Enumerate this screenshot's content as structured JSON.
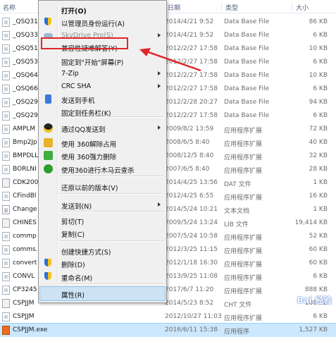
{
  "header": {
    "name": "名称",
    "date": "日期",
    "type": "类型",
    "size": "大小"
  },
  "files": [
    {
      "name": "_QSQ31",
      "date": "2014/4/21 9:52",
      "type": "Data Base File",
      "size": "86 KB",
      "icon": "app"
    },
    {
      "name": "_QSQ33",
      "date": "2014/4/21 9:52",
      "type": "Data Base File",
      "size": "6 KB",
      "icon": "app"
    },
    {
      "name": "_QSQ51",
      "date": "2012/2/27 17:58",
      "type": "Data Base File",
      "size": "10 KB",
      "icon": "app"
    },
    {
      "name": "_QSQ53",
      "date": "2012/2/27 17:58",
      "type": "Data Base File",
      "size": "6 KB",
      "icon": "app"
    },
    {
      "name": "_QSQ64",
      "date": "2012/2/27 17:58",
      "type": "Data Base File",
      "size": "10 KB",
      "icon": "app"
    },
    {
      "name": "_QSQ66",
      "date": "2012/2/27 17:58",
      "type": "Data Base File",
      "size": "6 KB",
      "icon": "app"
    },
    {
      "name": "_QSQ29",
      "date": "2012/2/28 20:27",
      "type": "Data Base File",
      "size": "94 KB",
      "icon": "app"
    },
    {
      "name": "_QSQ29",
      "date": "2012/2/27 17:58",
      "type": "Data Base File",
      "size": "6 KB",
      "icon": "app"
    },
    {
      "name": "AMPLM",
      "date": "2009/8/2 13:59",
      "type": "应用程序扩展",
      "size": "72 KB",
      "icon": "app"
    },
    {
      "name": "Bmp2Jp",
      "date": "2008/6/5 8:40",
      "type": "应用程序扩展",
      "size": "40 KB",
      "icon": "app"
    },
    {
      "name": "BMPDLL",
      "date": "2008/12/5 8:40",
      "type": "应用程序扩展",
      "size": "32 KB",
      "icon": "app"
    },
    {
      "name": "BORLNI",
      "date": "2007/6/5 8:40",
      "type": "应用程序扩展",
      "size": "28 KB",
      "icon": "app"
    },
    {
      "name": "CDK200",
      "date": "2014/4/25 13:56",
      "type": "DAT 文件",
      "size": "1 KB",
      "icon": "lib"
    },
    {
      "name": "CFindBl",
      "date": "2012/4/25 6:55",
      "type": "应用程序扩展",
      "size": "16 KB",
      "icon": "app"
    },
    {
      "name": "Change",
      "date": "2014/5/24 10:21",
      "type": "文本文档",
      "size": "1 KB",
      "icon": "txt"
    },
    {
      "name": "CHINES",
      "date": "2009/5/24 13:24",
      "type": "LIB 文件",
      "size": "19,414 KB",
      "icon": "lib"
    },
    {
      "name": "commp",
      "date": "2007/5/24 10:58",
      "type": "应用程序扩展",
      "size": "52 KB",
      "icon": "app"
    },
    {
      "name": "comms.",
      "date": "2012/3/25 11:15",
      "type": "应用程序扩展",
      "size": "60 KB",
      "icon": "app"
    },
    {
      "name": "convert",
      "date": "2012/1/18 16:30",
      "type": "应用程序扩展",
      "size": "60 KB",
      "icon": "app"
    },
    {
      "name": "CONVL",
      "date": "2013/9/25 11:08",
      "type": "应用程序扩展",
      "size": "6 KB",
      "icon": "app"
    },
    {
      "name": "CP3245",
      "date": "2017/6/7 11:20",
      "type": "应用程序扩展",
      "size": "888 KB",
      "icon": "app"
    },
    {
      "name": "CSPJJM",
      "date": "2014/5/23 8:52",
      "type": "CHT 文件",
      "size": "188 KB",
      "icon": "lib"
    },
    {
      "name": "CSPJJM",
      "date": "2012/10/27 11:03",
      "type": "应用程序扩展",
      "size": "6 KB",
      "icon": "app"
    },
    {
      "name": "CSPJJM.exe",
      "date": "2016/6/11 15:38",
      "type": "应用程序",
      "size": "1,527 KB",
      "icon": "orange"
    }
  ],
  "menu": {
    "items": [
      {
        "label": "打开(O)",
        "icon": "",
        "arrow": false,
        "bold": true
      },
      {
        "label": "以管理员身份运行(A)",
        "icon": "shield-icon",
        "arrow": false
      },
      {
        "label": "SkyDrive Pro(S)",
        "icon": "cloud-icon",
        "arrow": true,
        "disabled": true
      },
      {
        "label": "兼容性疑难解答(Y)",
        "icon": "",
        "arrow": false,
        "highlight": true
      },
      {
        "label": "固定到\"开始\"屏幕(P)",
        "icon": "",
        "arrow": false
      },
      {
        "label": "7-Zip",
        "icon": "",
        "arrow": true
      },
      {
        "label": "CRC SHA",
        "icon": "",
        "arrow": true
      },
      {
        "label": "发送到手机",
        "icon": "phone-icon",
        "arrow": false
      },
      {
        "label": "固定到任务栏(K)",
        "icon": "",
        "arrow": false
      },
      {
        "label": "通过QQ发送到",
        "icon": "qq-icon",
        "arrow": true
      },
      {
        "label": "使用 360解除占用",
        "icon": "360-unlock-icon",
        "arrow": false
      },
      {
        "label": "使用 360强力删除",
        "icon": "360-delete-icon",
        "arrow": false
      },
      {
        "label": "使用360进行木马云查杀",
        "icon": "360-scan-icon",
        "arrow": false
      },
      {
        "label": "还原以前的版本(V)",
        "icon": "",
        "arrow": false
      },
      {
        "label": "发送到(N)",
        "icon": "",
        "arrow": true
      },
      {
        "label": "剪切(T)",
        "icon": "",
        "arrow": false
      },
      {
        "label": "复制(C)",
        "icon": "",
        "arrow": false
      },
      {
        "label": "创建快捷方式(S)",
        "icon": "",
        "arrow": false
      },
      {
        "label": "删除(D)",
        "icon": "shield-icon",
        "arrow": false
      },
      {
        "label": "重命名(M)",
        "icon": "shield-icon",
        "arrow": false
      },
      {
        "label": "属性(R)",
        "icon": "",
        "arrow": false,
        "hover": true
      }
    ]
  },
  "colors": {
    "highlight_box": "#e0262a",
    "selection": "#cce8ff",
    "menu_bg": "#f0f0f0"
  },
  "watermark": "Bai 经验"
}
